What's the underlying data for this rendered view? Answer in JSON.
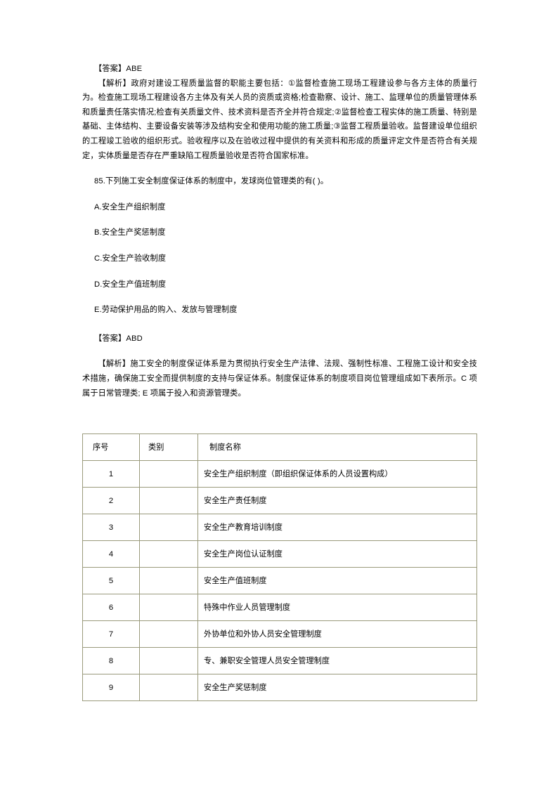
{
  "document": {
    "answer_label_1": "【答案】ABE",
    "analysis_1": "【解析】政府对建设工程质量监督的职能主要包括：①监督检查施工现场工程建设参与各方主体的质量行为。检查施工现场工程建设各方主体及有关人员的资质或资格;检查勘察、设计、施工、监理单位的质量管理体系和质量责任落实情况;检查有关质量文件、技术资料是否齐全并符合规定;②监督检查工程实体的施工质量、特别是基础、主体结构、主要设备安装等涉及结构安全和使用功能的施工质量;③监督工程质量验收。监督建设单位组织的工程竣工验收的组织形式。验收程序以及在验收过程中提供的有关资料和形成的质量评定文件是否符合有关规定，实体质量是否存在严重缺陷工程质量验收是否符合国家标准。",
    "question": {
      "number": "85.",
      "text": "下列施工安全制度保证体系的制度中，发球岗位管理类的有(",
      "blank": "    ",
      "close": ")。",
      "full": "85.下列施工安全制度保证体系的制度中，发球岗位管理类的有(    )。"
    },
    "options": [
      "A.安全生产组织制度",
      "B.安全生产奖惩制度",
      "C.安全生产验收制度",
      "D.安全生产值班制度",
      "E.劳动保护用品的购入、发放与管理制度"
    ],
    "answer_label_2": "【答案】ABD",
    "analysis_2": "【解析】施工安全的制度保证体系是为贯彻执行安全生产法律、法规、强制性标准、工程施工设计和安全技术措施，确保施工安全而提供制度的支持与保证体系。制度保证体系的制度项目岗位管理组成如下表所示。C 项属于日常管理类; E 项属于投入和资源管理类。"
  },
  "table": {
    "headers": [
      "序号",
      "类别",
      "制度名称"
    ],
    "rows": [
      {
        "no": "1",
        "cat": "",
        "name": "安全生产组织制度（即组织保证体系的人员设置构成）"
      },
      {
        "no": "2",
        "cat": "",
        "name": "安全生产责任制度"
      },
      {
        "no": "3",
        "cat": "",
        "name": "安全生产教育培训制度"
      },
      {
        "no": "4",
        "cat": "",
        "name": "安全生产岗位认证制度"
      },
      {
        "no": "5",
        "cat": "",
        "name": "安全生产值班制度"
      },
      {
        "no": "6",
        "cat": "",
        "name": "特殊中作业人员管理制度"
      },
      {
        "no": "7",
        "cat": "",
        "name": "外协单位和外协人员安全管理制度"
      },
      {
        "no": "8",
        "cat": "",
        "name": "专、兼职安全管理人员安全管理制度"
      },
      {
        "no": "9",
        "cat": "",
        "name": "安全生产奖惩制度"
      }
    ]
  },
  "colors": {
    "page_background": "#ffffff",
    "text": "#000000",
    "table_border": "#9a9a7c"
  }
}
